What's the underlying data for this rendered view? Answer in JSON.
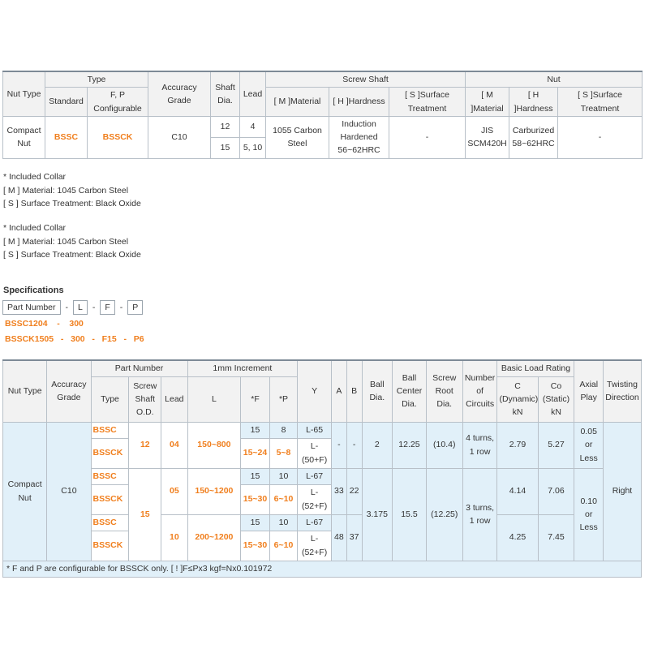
{
  "overview": {
    "headers": {
      "nut_type": "Nut Type",
      "type": "Type",
      "standard": "Standard",
      "fp_configurable_1": "F, P",
      "fp_configurable_2": "Configurable",
      "accuracy_1": "Accuracy",
      "accuracy_2": "Grade",
      "shaft_1": "Shaft",
      "shaft_2": "Dia.",
      "lead": "Lead",
      "screw_shaft": "Screw Shaft",
      "nut": "Nut",
      "shaft_material": "[ M ]Material",
      "shaft_hardness": "[ H ]Hardness",
      "shaft_surface_1": "[ S ]Surface",
      "shaft_surface_2": "Treatment",
      "nut_material_1": "[ M",
      "nut_material_2": "]Material",
      "nut_hardness_1": "[ H",
      "nut_hardness_2": "]Hardness",
      "nut_surface_1": "[ S ]Surface",
      "nut_surface_2": "Treatment"
    },
    "row": {
      "nut_type_1": "Compact",
      "nut_type_2": "Nut",
      "standard": "BSSC",
      "configurable": "BSSCK",
      "accuracy": "C10",
      "shaft_dia_1": "12",
      "lead_1": "4",
      "shaft_dia_2": "15",
      "lead_2": "5, 10",
      "shaft_material_1": "1055 Carbon",
      "shaft_material_2": "Steel",
      "shaft_hardness_1": "Induction",
      "shaft_hardness_2": "Hardened",
      "shaft_hardness_3": "56~62HRC",
      "shaft_surface": "-",
      "nut_material_1": "JIS",
      "nut_material_2": "SCM420H",
      "nut_hardness_1": "Carburized",
      "nut_hardness_2": "58~62HRC",
      "nut_surface": "-"
    }
  },
  "notes_a": [
    "* Included Collar",
    "[ M ] Material: 1045 Carbon Steel",
    "[ S ] Surface Treatment: Black Oxide"
  ],
  "notes_b": [
    "* Included Collar",
    "[ M ] Material: 1045 Carbon Steel",
    "[ S ] Surface Treatment: Black Oxide"
  ],
  "specifications": {
    "title": "Specifications",
    "part_number_box": "Part Number",
    "dash": "-",
    "box_l": "L",
    "box_f": "F",
    "box_p": "P",
    "example_1": "BSSC1204    -    300",
    "example_2": "BSSCK1505   -   300   -   F15   -   P6"
  },
  "spec_table": {
    "headers": {
      "nut_type": "Nut Type",
      "accuracy_1": "Accuracy",
      "accuracy_2": "Grade",
      "part_number": "Part Number",
      "type": "Type",
      "screw_od_1": "Screw",
      "screw_od_2": "Shaft",
      "screw_od_3": "O.D.",
      "lead": "Lead",
      "increment": "1mm Increment",
      "l": "L",
      "f": "*F",
      "p": "*P",
      "y": "Y",
      "a": "A",
      "b": "B",
      "ball_dia_1": "Ball",
      "ball_dia_2": "Dia.",
      "ball_center_1": "Ball",
      "ball_center_2": "Center",
      "ball_center_3": "Dia.",
      "screw_root_1": "Screw",
      "screw_root_2": "Root",
      "screw_root_3": "Dia.",
      "circuits_1": "Number",
      "circuits_2": "of",
      "circuits_3": "Circuits",
      "load_rating": "Basic Load Rating",
      "c_1": "C",
      "c_2": "(Dynamic)",
      "c_3": "kN",
      "co_1": "Co",
      "co_2": "(Static)",
      "co_3": "kN",
      "axial_1": "Axial",
      "axial_2": "Play",
      "twist_1": "Twisting",
      "twist_2": "Direction"
    },
    "nut_type_1": "Compact",
    "nut_type_2": "Nut",
    "accuracy": "C10",
    "twisting": "Right",
    "od_15": "15",
    "ball_dia_15": "3.175",
    "ball_center_15": "15.5",
    "root_15": "(12.25)",
    "circuits_15_1": "3 turns,",
    "circuits_15_2": "1 row",
    "axial_15_1": "0.10",
    "axial_15_2": "or",
    "axial_15_3": "Less",
    "group1": {
      "bssc": "BSSC",
      "bssck": "BSSCK",
      "od": "12",
      "lead": "04",
      "l": "150~800",
      "f_std": "15",
      "p_std": "8",
      "y_std": "L-65",
      "f_cfg": "15~24",
      "p_cfg": "5~8",
      "y_cfg_1": "L-",
      "y_cfg_2": "(50+F)",
      "a": "-",
      "b": "-",
      "ball": "2",
      "center": "12.25",
      "root": "(10.4)",
      "circ_1": "4 turns,",
      "circ_2": "1 row",
      "c": "2.79",
      "co": "5.27",
      "axial_1": "0.05",
      "axial_2": "or",
      "axial_3": "Less"
    },
    "group2": {
      "bssc": "BSSC",
      "bssck": "BSSCK",
      "lead": "05",
      "l": "150~1200",
      "f_std": "15",
      "p_std": "10",
      "y_std": "L-67",
      "f_cfg": "15~30",
      "p_cfg": "6~10",
      "y_cfg_1": "L-",
      "y_cfg_2": "(52+F)",
      "a": "33",
      "b": "22",
      "c": "4.14",
      "co": "7.06"
    },
    "group3": {
      "bssc": "BSSC",
      "bssck": "BSSCK",
      "lead": "10",
      "l": "200~1200",
      "f_std": "15",
      "p_std": "10",
      "y_std": "L-67",
      "f_cfg": "15~30",
      "p_cfg": "6~10",
      "y_cfg_1": "L-",
      "y_cfg_2": "(52+F)",
      "a": "48",
      "b": "37",
      "c": "4.25",
      "co": "7.45"
    },
    "footnote": "* F and P are configurable for BSSCK only. [ ! ]F≤Px3 kgf=Nx0.101972"
  }
}
